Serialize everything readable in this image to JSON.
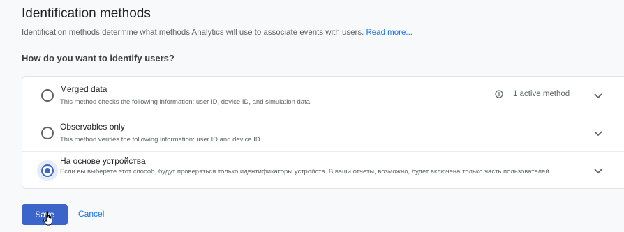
{
  "header": {
    "title": "Identification methods",
    "description": "Identification methods determine what methods Analytics will use to associate events with users.",
    "read_more_label": "Read more..."
  },
  "question": "How do you want to identify users?",
  "options": [
    {
      "label": "Merged data",
      "description": "This method checks the following information: user ID, device ID, and simulation data.",
      "status": "1 active method",
      "selected": false
    },
    {
      "label": "Observables only",
      "description": "This method verifies the following information: user ID and device ID.",
      "selected": false
    },
    {
      "label": "На основе устройства",
      "description": "Если вы выберете этот способ, будут проверяться только идентификаторы устройств. В ваши отчеты, возможно, будет включена только часть пользователей.",
      "selected": true
    }
  ],
  "actions": {
    "save_label": "Save",
    "cancel_label": "Cancel"
  },
  "colors": {
    "accent": "#3c65c9",
    "link": "#1a73e8"
  },
  "icons": [
    "info-icon",
    "chevron-down-icon",
    "hand-cursor-icon"
  ]
}
